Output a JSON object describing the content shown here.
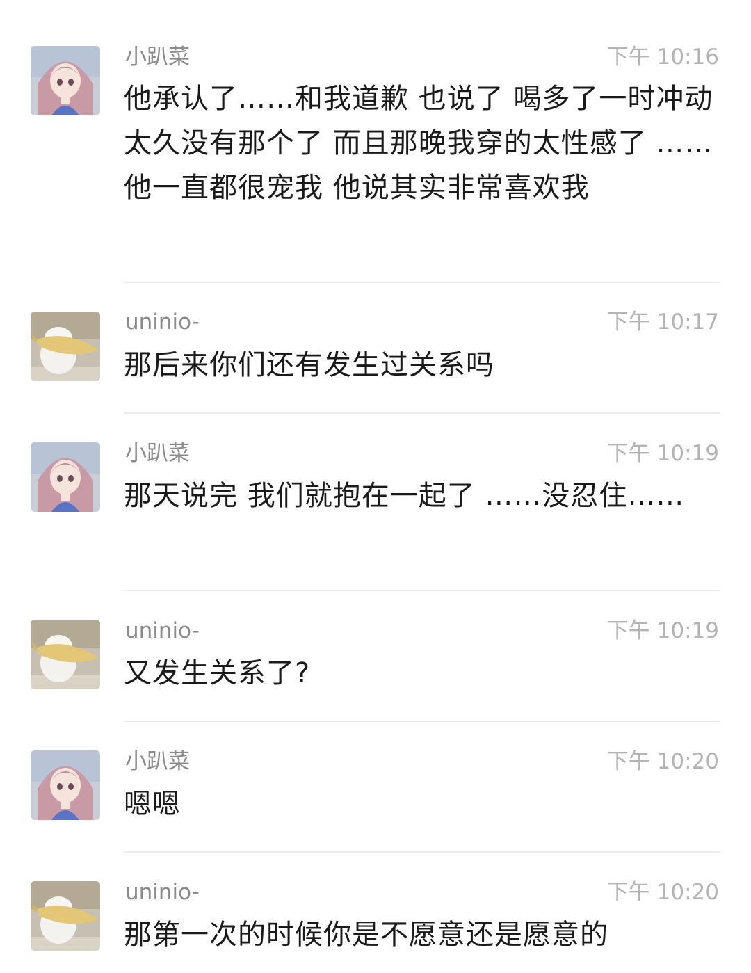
{
  "messages": [
    {
      "sender": "小趴菜",
      "avatar": "anime-girl-avatar",
      "time": "下午 10:16",
      "text": "他承认了……和我道歉  也说了  喝多了一时冲动   太久没有那个了   而且那晚我穿的太性感了  ……他一直都很宠我  他说其实非常喜欢我"
    },
    {
      "sender": "uninio-",
      "avatar": "cat-with-fish-avatar",
      "time": "下午 10:17",
      "text": "那后来你们还有发生过关系吗"
    },
    {
      "sender": "小趴菜",
      "avatar": "anime-girl-avatar",
      "time": "下午 10:19",
      "text": "那天说完  我们就抱在一起了  ……没忍住……"
    },
    {
      "sender": "uninio-",
      "avatar": "cat-with-fish-avatar",
      "time": "下午 10:19",
      "text": "又发生关系了?"
    },
    {
      "sender": "小趴菜",
      "avatar": "anime-girl-avatar",
      "time": "下午 10:20",
      "text": "嗯嗯"
    },
    {
      "sender": "uninio-",
      "avatar": "cat-with-fish-avatar",
      "time": "下午 10:20",
      "text": "那第一次的时候你是不愿意还是愿意的"
    }
  ]
}
